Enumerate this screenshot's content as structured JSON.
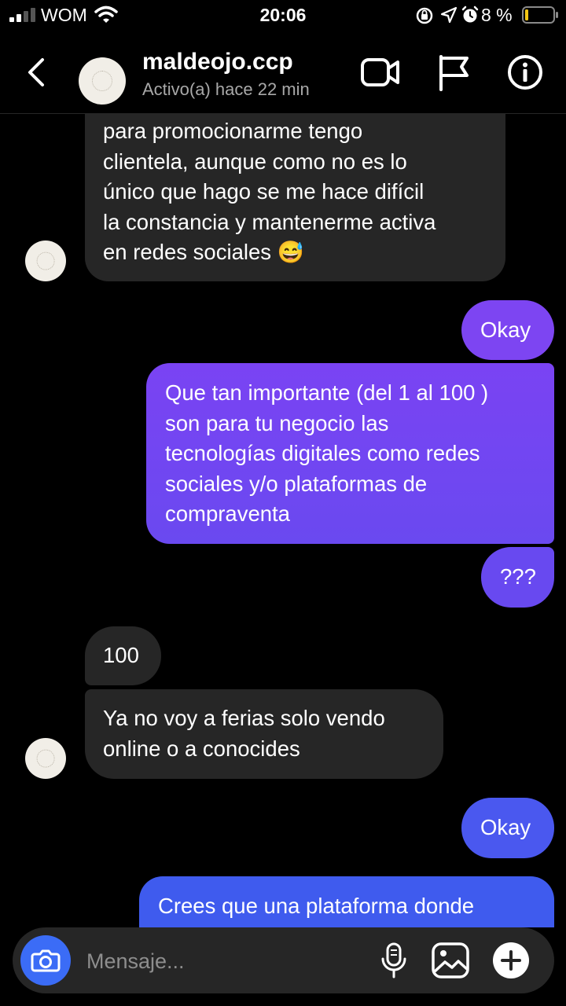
{
  "status_bar": {
    "carrier": "WOM",
    "time": "20:06",
    "battery": "8 %"
  },
  "header": {
    "contact_name": "maldeojo.ccp",
    "contact_status": "Activo(a) hace 22 min"
  },
  "messages": [
    {
      "direction": "incoming",
      "text": "para promocionarme tengo\nclientela, aunque como no es lo\núnico que hago se me hace difícil\nla constancia y mantenerme activa\nen redes sociales 😅"
    },
    {
      "direction": "outgoing",
      "text": "Okay"
    },
    {
      "direction": "outgoing",
      "text": "Que tan importante (del 1 al 100 )\nson para tu negocio las\ntecnologías digitales como redes\nsociales y/o plataformas de\ncompraventa"
    },
    {
      "direction": "outgoing",
      "text": "???"
    },
    {
      "direction": "incoming",
      "text": "100"
    },
    {
      "direction": "incoming",
      "text": "Ya no voy a ferias solo vendo\nonline o a conocides"
    },
    {
      "direction": "outgoing",
      "text": "Okay"
    },
    {
      "direction": "outgoing",
      "text": "Crees que una plataforma donde"
    }
  ],
  "composer": {
    "placeholder": "Mensaje..."
  },
  "colors": {
    "incoming_bubble": "#262626",
    "outgoing_gradient": [
      "#8a3ff0",
      "#3b55ee"
    ],
    "camera_button": "#3b6cf6"
  }
}
